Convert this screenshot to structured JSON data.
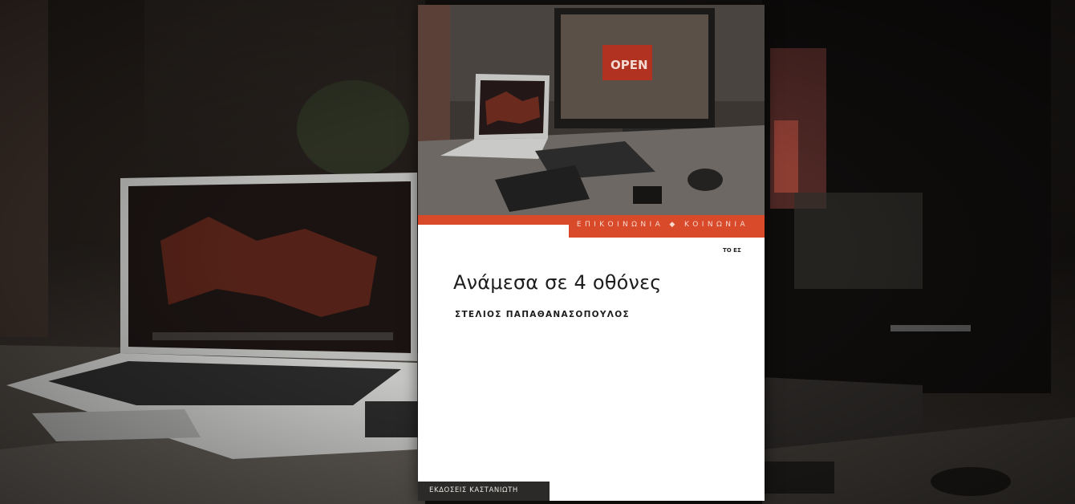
{
  "image": {
    "description_kind": "book cover composited over a blurred desk photograph"
  },
  "book": {
    "series": "ΕΠΙΚΟΙΝΩΝΙΑ ◆ ΚΟΙΝΩΝΙΑ",
    "title": "Ανάμεσα σε 4 οθόνες",
    "author": "ΣΤΕΛΙΟΣ ΠΑΠΑΘΑΝΑΣΟΠΟΥΛΟΣ",
    "publisher": "ΕΚΔΟΣΕΙΣ ΚΑΣΤΑΝΙΩΤΗ",
    "logo_text": "ΤΟ ΕΣ",
    "photo_sign_text": "OPEN"
  },
  "colors": {
    "accent_red": "#d94a2a",
    "cover_white": "#ffffff",
    "publisher_box": "#2b2a28"
  }
}
